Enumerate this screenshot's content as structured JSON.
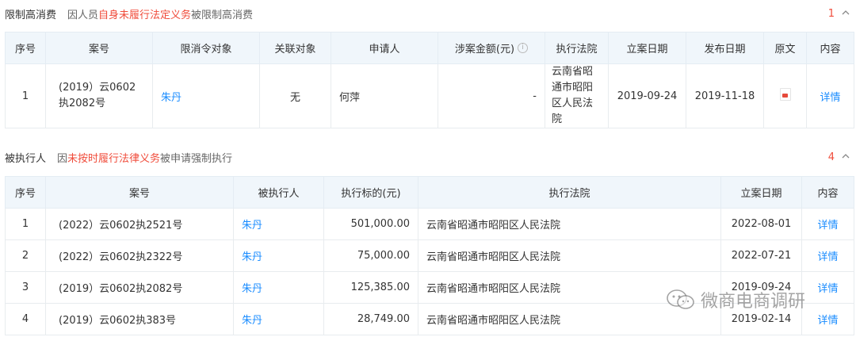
{
  "section1": {
    "title": "限制高消费",
    "desc_pre": "因人员",
    "desc_hl": "自身未履行法定义务",
    "desc_post": "被限制高消费",
    "count": "1",
    "headers": [
      "序号",
      "案号",
      "限消令对象",
      "关联对象",
      "申请人",
      "涉案金额(元)",
      "执行法院",
      "立案日期",
      "发布日期",
      "原文",
      "内容"
    ],
    "rows": [
      {
        "no": "1",
        "case": "(2019）云0602执2082号",
        "target": "朱丹",
        "related": "无",
        "applicant": "何萍",
        "amount": "-",
        "court": "云南省昭通市昭阳区人民法院",
        "filed": "2019-09-24",
        "published": "2019-11-18",
        "doc_icon": "pdf-file-icon",
        "detail": "详情"
      }
    ]
  },
  "section2": {
    "title": "被执行人",
    "desc_pre": "因",
    "desc_hl": "未按时履行法律义务",
    "desc_post": "被申请强制执行",
    "count": "4",
    "headers": [
      "序号",
      "案号",
      "被执行人",
      "执行标的(元)",
      "执行法院",
      "立案日期",
      "内容"
    ],
    "rows": [
      {
        "no": "1",
        "case": "(2022）云0602执2521号",
        "person": "朱丹",
        "amount": "501,000.00",
        "court": "云南省昭通市昭阳区人民法院",
        "filed": "2022-08-01",
        "detail": "详情"
      },
      {
        "no": "2",
        "case": "(2022）云0602执2322号",
        "person": "朱丹",
        "amount": "75,000.00",
        "court": "云南省昭通市昭阳区人民法院",
        "filed": "2022-07-21",
        "detail": "详情"
      },
      {
        "no": "3",
        "case": "(2019）云0602执2082号",
        "person": "朱丹",
        "amount": "125,385.00",
        "court": "云南省昭通市昭阳区人民法院",
        "filed": "2019-09-24",
        "detail": "详情"
      },
      {
        "no": "4",
        "case": "(2019）云0602执383号",
        "person": "朱丹",
        "amount": "28,749.00",
        "court": "云南省昭通市昭阳区人民法院",
        "filed": "2019-02-14",
        "detail": "详情"
      }
    ]
  },
  "watermark": {
    "text": "微商电商调研",
    "icon": "wechat-icon"
  },
  "colors": {
    "highlight": "#f04c3b",
    "link": "#1a8cff",
    "header_bg": "#f0f6fb"
  }
}
